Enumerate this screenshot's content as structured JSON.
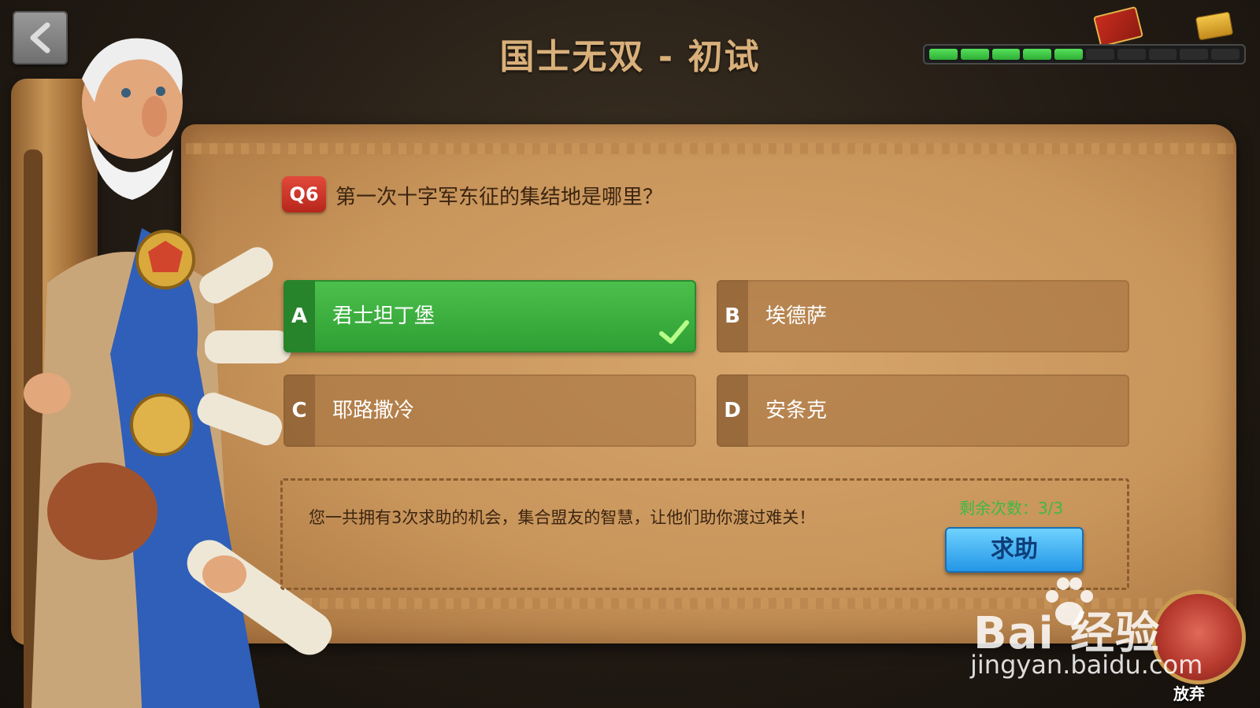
{
  "header": {
    "title": "国士无双 - 初试",
    "progress": {
      "segments_total": 10,
      "segments_filled": 5
    }
  },
  "question": {
    "number_badge": "Q6",
    "text": "第一次十字军东征的集结地是哪里？"
  },
  "options": [
    {
      "letter": "A",
      "label": "君士坦丁堡",
      "state": "correct"
    },
    {
      "letter": "B",
      "label": "埃德萨",
      "state": "default"
    },
    {
      "letter": "C",
      "label": "耶路撒冷",
      "state": "default"
    },
    {
      "letter": "D",
      "label": "安条克",
      "state": "default"
    }
  ],
  "help": {
    "description": "您一共拥有3次求助的机会，集合盟友的智慧，让他们助你渡过难关！",
    "remaining": "剩余次数：3/3",
    "button_label": "求助"
  },
  "abandon": {
    "label": "放弃"
  },
  "watermark": {
    "brand": "Bai 经验",
    "url": "jingyan.baidu.com"
  },
  "colors": {
    "correct_green": "#3db43f",
    "help_blue": "#3aa7f0",
    "badge_red": "#d1372a",
    "title_gold": "#d9b07a"
  }
}
